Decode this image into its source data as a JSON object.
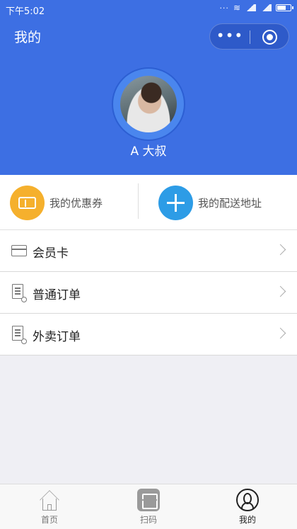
{
  "status_bar": {
    "time": "下午5:02"
  },
  "nav": {
    "title": "我的",
    "capsule_more": "•••",
    "capsule_close_icon": "record-icon"
  },
  "profile": {
    "username": "A 大叔"
  },
  "quick_actions": {
    "coupons": {
      "label": "我的优惠券",
      "icon": "ticket-icon",
      "color": "#f5b02d"
    },
    "address": {
      "label": "我的配送地址",
      "icon": "plus-icon",
      "color": "#2d9ce6"
    }
  },
  "menu": {
    "items": [
      {
        "label": "会员卡",
        "icon": "card-icon"
      },
      {
        "label": "普通订单",
        "icon": "order-doc-icon"
      },
      {
        "label": "外卖订单",
        "icon": "order-doc-icon"
      }
    ]
  },
  "tabbar": {
    "tabs": [
      {
        "label": "首页",
        "icon": "home-icon",
        "active": false
      },
      {
        "label": "扫码",
        "icon": "scan-icon",
        "active": false
      },
      {
        "label": "我的",
        "icon": "user-icon",
        "active": true
      }
    ]
  },
  "colors": {
    "header_bg": "#3d6fe3",
    "page_bg": "#efeff4"
  }
}
